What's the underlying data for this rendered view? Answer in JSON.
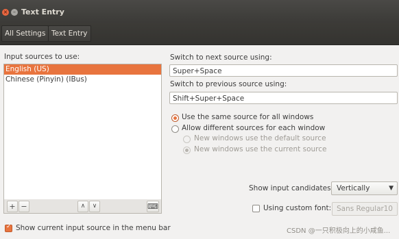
{
  "window": {
    "title": "Text Entry",
    "close_glyph": "×",
    "minimize_glyph": "–"
  },
  "toolbar": {
    "all_settings_label": "All Settings",
    "text_entry_label": "Text Entry"
  },
  "input_sources": {
    "heading": "Input sources to use:",
    "items": [
      {
        "label": "English (US)",
        "selected": true
      },
      {
        "label": "Chinese (Pinyin) (IBus)",
        "selected": false
      }
    ],
    "add_glyph": "+",
    "remove_glyph": "−",
    "up_glyph": "∧",
    "down_glyph": "∨",
    "keyboard_glyph": "⌨"
  },
  "shortcuts": {
    "next_label": "Switch to next source using:",
    "next_value": "Super+Space",
    "prev_label": "Switch to previous source using:",
    "prev_value": "Shift+Super+Space"
  },
  "source_mode": {
    "same_label": "Use the same source for all windows",
    "different_label": "Allow different sources for each window",
    "new_default_label": "New windows use the default source",
    "new_current_label": "New windows use the current source",
    "selected": "same"
  },
  "candidates": {
    "label": "Show input candidates:",
    "value": "Vertically",
    "arrow_glyph": "▼"
  },
  "custom_font": {
    "label": "Using custom font:",
    "checked": false,
    "font_name": "Sans Regular",
    "font_size": "10"
  },
  "menu_bar": {
    "label": "Show current input source in the menu bar",
    "checked": true
  },
  "watermark": "CSDN @一只积极向上的小咸鱼...",
  "colors": {
    "accent": "#e8743e",
    "titlebar": "#3b3a37",
    "window_bg": "#f2f1f0"
  }
}
